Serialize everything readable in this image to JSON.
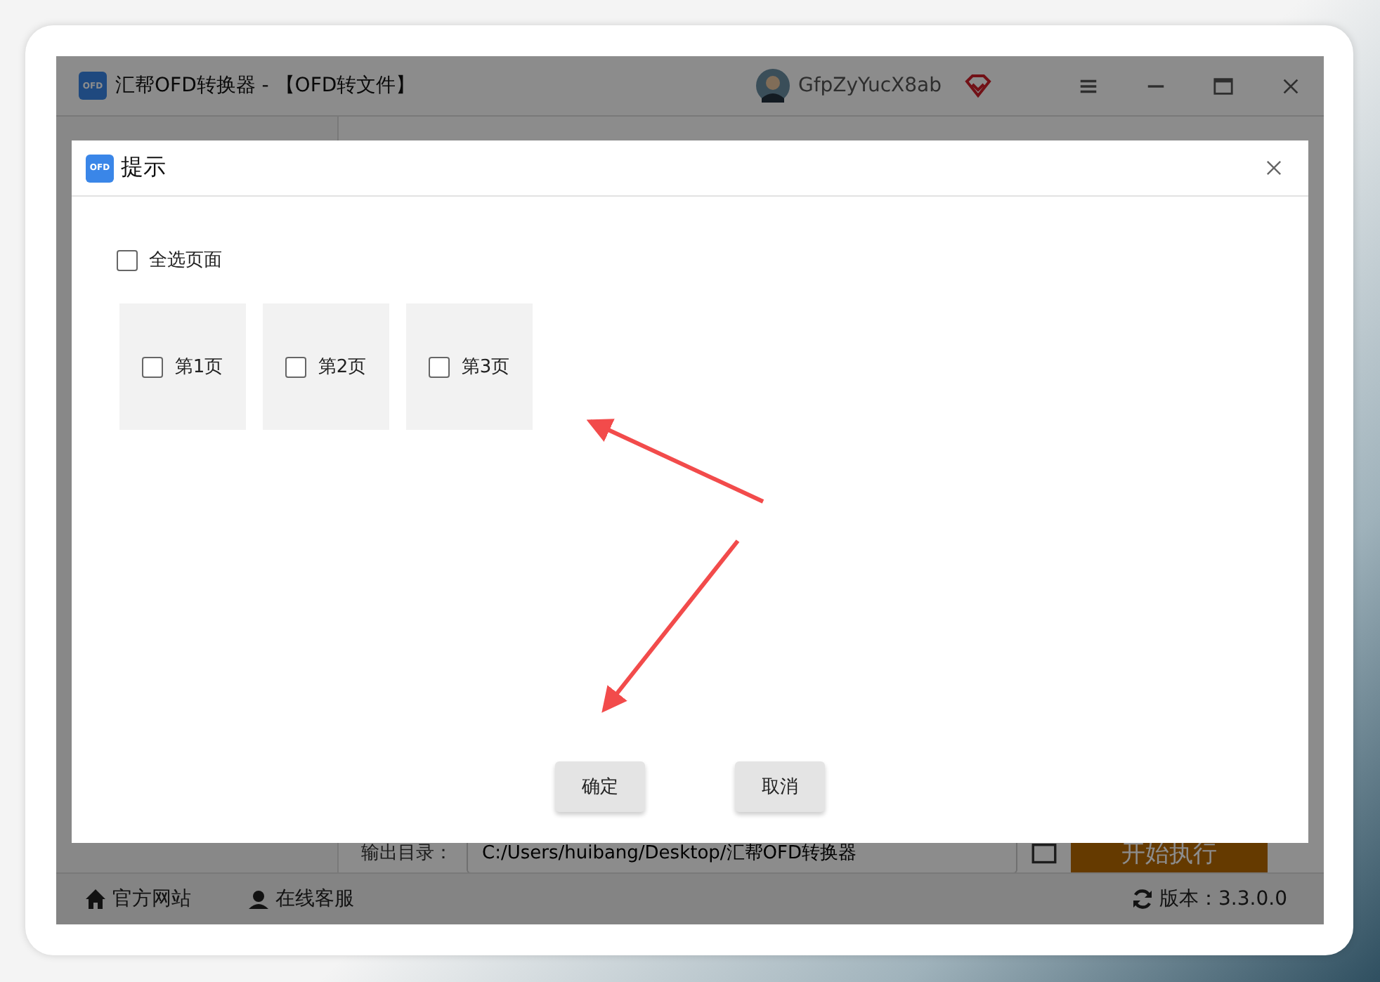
{
  "window": {
    "icon_text": "OFD",
    "title": "汇帮OFD转换器 - 【OFD转文件】",
    "user": "GfpZyYucX8ab"
  },
  "output": {
    "label": "输出目录：",
    "path": "C:/Users/huibang/Desktop/汇帮OFD转换器",
    "start_button": "开始执行"
  },
  "status_bar": {
    "links": [
      "官方网站",
      "在线客服"
    ],
    "version": "版本：3.3.0.0"
  },
  "dialog": {
    "icon_text": "OFD",
    "title": "提示",
    "select_all": {
      "label": "全选页面",
      "checked": false
    },
    "pages": [
      {
        "label": "第1页",
        "checked": false
      },
      {
        "label": "第2页",
        "checked": false
      },
      {
        "label": "第3页",
        "checked": false
      }
    ],
    "buttons": [
      "确定",
      "取消"
    ]
  }
}
